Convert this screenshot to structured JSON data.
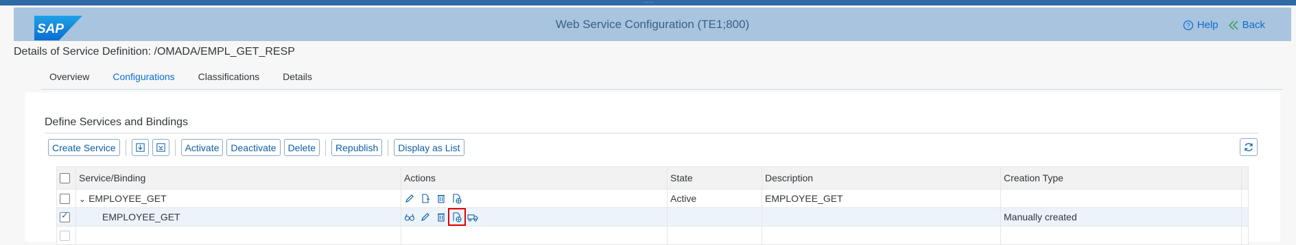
{
  "colors": {
    "accent": "#0a6ed1",
    "header_bg": "#a9c4de",
    "highlight": "#e00000"
  },
  "header": {
    "logo_text": "SAP",
    "title": "Web Service Configuration (TE1;800)",
    "help_label": "Help",
    "back_label": "Back"
  },
  "page": {
    "title": "Details of Service Definition: /OMADA/EMPL_GET_RESP"
  },
  "tabs": [
    {
      "label": "Overview"
    },
    {
      "label": "Configurations",
      "active": true
    },
    {
      "label": "Classifications"
    },
    {
      "label": "Details"
    }
  ],
  "section": {
    "title": "Define Services and Bindings"
  },
  "toolbar": {
    "create_service": "Create Service",
    "activate": "Activate",
    "deactivate": "Deactivate",
    "delete": "Delete",
    "republish": "Republish",
    "display_as_list": "Display as List"
  },
  "table": {
    "columns": [
      "Service/Binding",
      "Actions",
      "State",
      "Description",
      "Creation Type"
    ],
    "rows": [
      {
        "name": "EMPLOYEE_GET",
        "state": "Active",
        "description": "EMPLOYEE_GET",
        "creation_type": "",
        "checked": false,
        "expanded": true
      },
      {
        "name": "EMPLOYEE_GET",
        "state": "",
        "description": "",
        "creation_type": "Manually created",
        "checked": true
      },
      {
        "name": "",
        "state": "",
        "description": "",
        "creation_type": "",
        "checked": false
      }
    ]
  }
}
